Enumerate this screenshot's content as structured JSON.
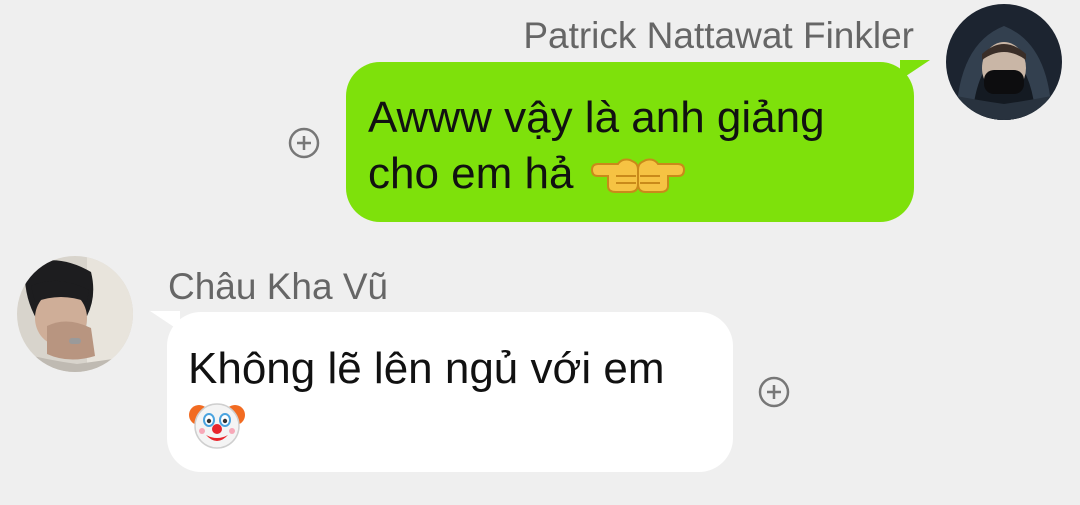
{
  "messages": {
    "outgoing": {
      "sender": "Patrick Nattawat Finkler",
      "line1": "Awww vậy là anh giảng",
      "line2": "cho em hả",
      "emoji": "pointing-hands-icon",
      "bubble_color": "#7ee10b"
    },
    "incoming": {
      "sender": "Châu Kha Vũ",
      "line1": "Không lẽ lên ngủ với em",
      "emoji": "clown-face-icon",
      "bubble_color": "#ffffff"
    }
  },
  "theme": {
    "background": "#efefef",
    "name_color": "#666666",
    "add_icon_color": "#777777"
  }
}
